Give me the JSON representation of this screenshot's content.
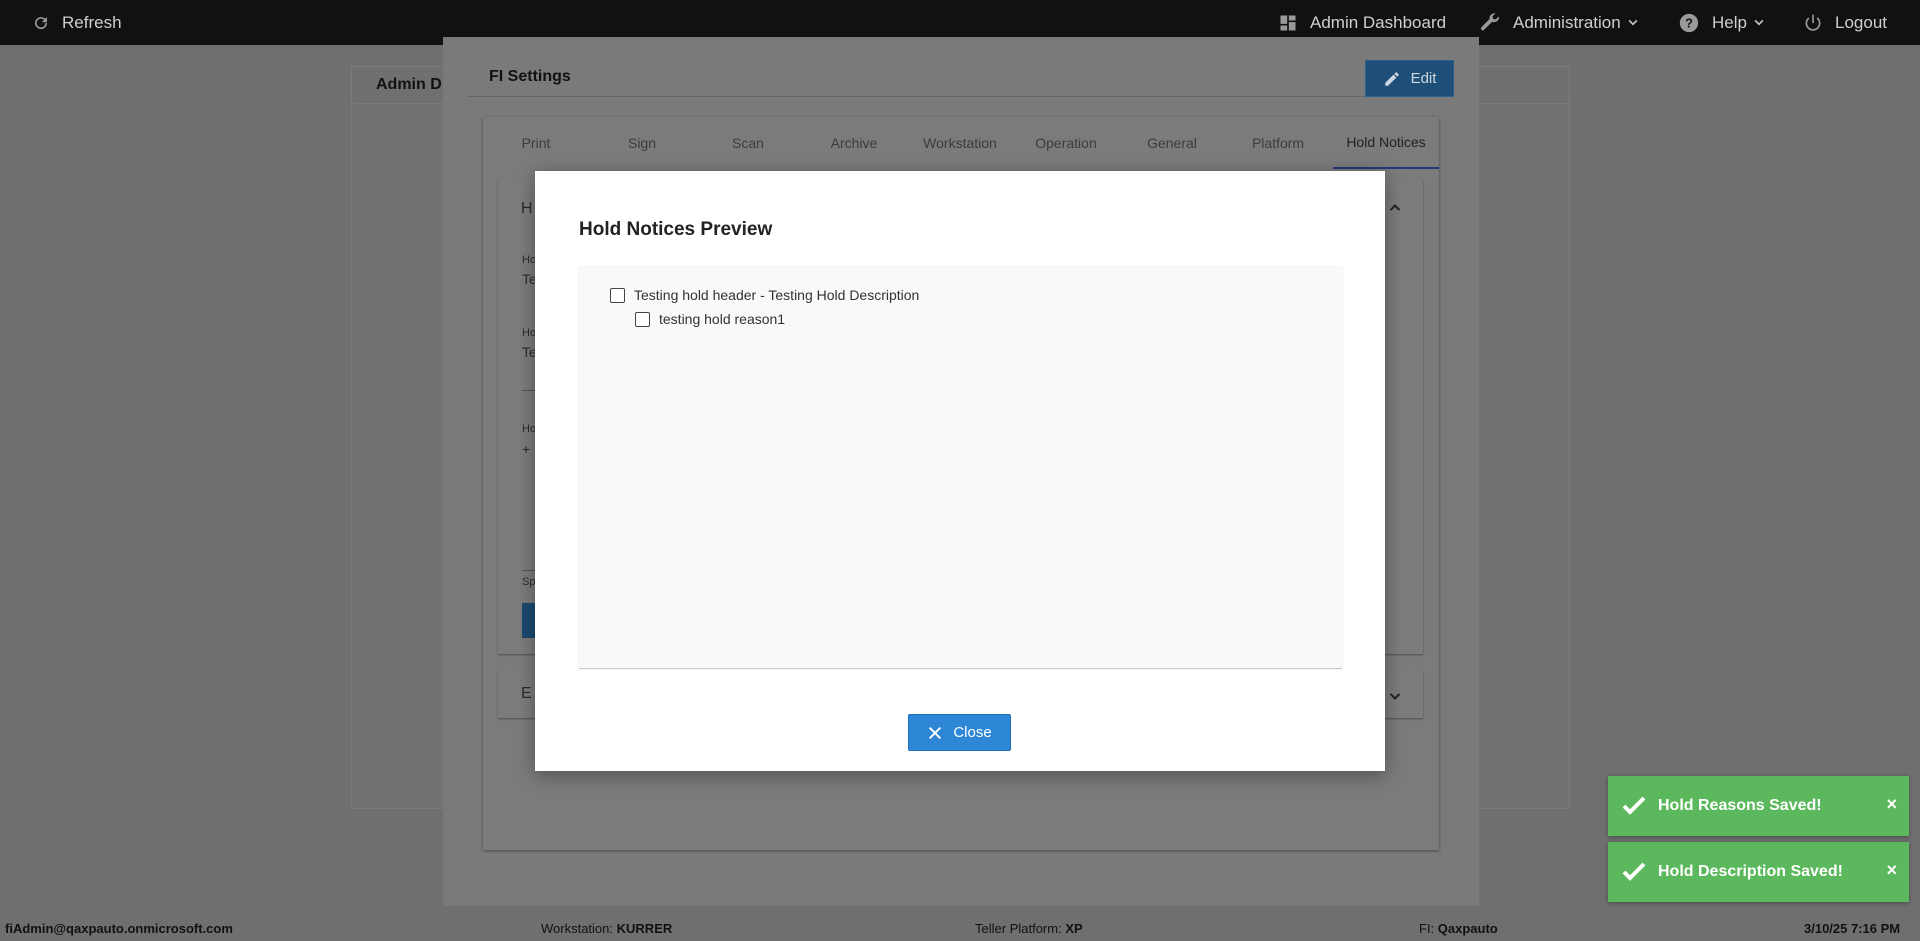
{
  "topbar": {
    "refresh": "Refresh",
    "admin_dashboard": "Admin Dashboard",
    "administration": "Administration",
    "help": "Help",
    "logout": "Logout"
  },
  "background": {
    "card_title": "Admin D"
  },
  "fi_settings": {
    "title": "FI Settings",
    "edit_label": "Edit",
    "tabs": [
      "Print",
      "Sign",
      "Scan",
      "Archive",
      "Workstation",
      "Operation",
      "General",
      "Platform",
      "Hold Notices"
    ],
    "active_tab": "Hold Notices",
    "fragments": {
      "section1_initial": "H",
      "label1": "Ho",
      "value1": "Te",
      "label2": "Ho",
      "value2": "Te",
      "label3": "Ho",
      "value3": "+ '",
      "label4": "Sp",
      "section2_initial": "E"
    }
  },
  "preview": {
    "title": "Hold Notices Preview",
    "items": [
      {
        "label": "Testing hold header - Testing Hold Description",
        "checked": false,
        "level": 0
      },
      {
        "label": "testing hold reason1",
        "checked": false,
        "level": 1
      }
    ],
    "close_label": "Close"
  },
  "toasts": [
    {
      "message": "Hold Reasons Saved!",
      "close": "×"
    },
    {
      "message": "Hold Description Saved!",
      "close": "×"
    }
  ],
  "footer": {
    "user": "fiAdmin@qaxpauto.onmicrosoft.com",
    "workstation_label": "Workstation:",
    "workstation_value": "KURRER",
    "platform_label": "Teller Platform:",
    "platform_value": "XP",
    "fi_label": "FI:",
    "fi_value": "Qaxpauto",
    "datetime": "3/10/25 7:16 PM"
  },
  "colors": {
    "primary_button": "#2e86d6",
    "toast_success": "#5cb85c",
    "topbar": "#111111",
    "overlay_backdrop": "#6f6f6f"
  }
}
